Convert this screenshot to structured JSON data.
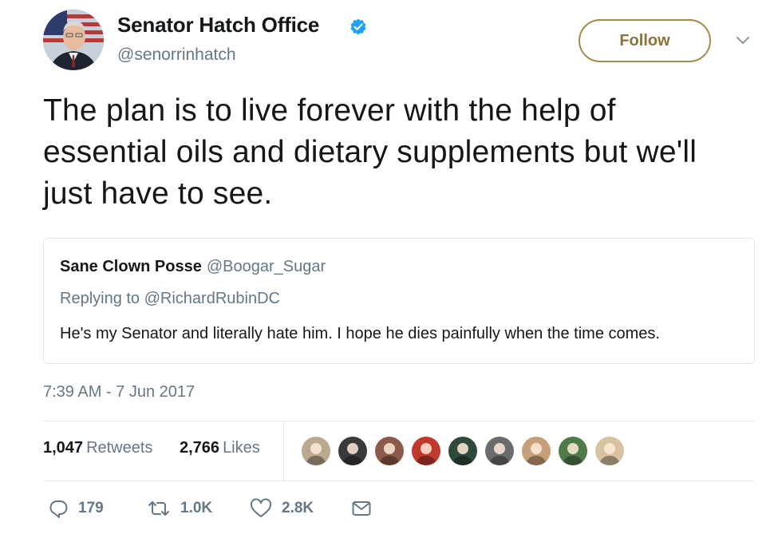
{
  "author": {
    "display_name": "Senator Hatch Office",
    "handle": "@senorrinhatch",
    "verified": true,
    "avatar_icon": "senator-portrait-avatar"
  },
  "follow_button": {
    "label": "Follow",
    "color": "#a48b4d"
  },
  "menu_icon": "chevron-down-icon",
  "tweet": {
    "text": "The plan is to live forever with the help of essential oils and dietary supplements but we'll just have to see.",
    "timestamp": "7:39 AM - 7 Jun 2017"
  },
  "quoted_tweet": {
    "display_name": "Sane Clown Posse",
    "handle": "@Boogar_Sugar",
    "replying_to": "Replying to @RichardRubinDC",
    "text": "He's my Senator and literally hate him. I hope he dies painfully when the time comes."
  },
  "stats": {
    "retweets": {
      "count": "1,047",
      "label": "Retweets"
    },
    "likes": {
      "count": "2,766",
      "label": "Likes"
    }
  },
  "likers": [
    {
      "icon": "liker-avatar-1",
      "color": "#b9a98e"
    },
    {
      "icon": "liker-avatar-2",
      "color": "#3a3a3a"
    },
    {
      "icon": "liker-avatar-3",
      "color": "#8c5a4a"
    },
    {
      "icon": "liker-avatar-4-maple-leaf",
      "color": "#c0392b"
    },
    {
      "icon": "liker-avatar-5",
      "color": "#2e4a3a"
    },
    {
      "icon": "liker-avatar-6",
      "color": "#6b6b6b"
    },
    {
      "icon": "liker-avatar-7",
      "color": "#c7a07a"
    },
    {
      "icon": "liker-avatar-8",
      "color": "#4f7b4a"
    },
    {
      "icon": "liker-avatar-9",
      "color": "#d8c3a0"
    }
  ],
  "actions": {
    "reply": {
      "icon": "reply-icon",
      "count": "179"
    },
    "retweet": {
      "icon": "retweet-icon",
      "count": "1.0K"
    },
    "like": {
      "icon": "heart-icon",
      "count": "2.8K"
    },
    "message": {
      "icon": "envelope-icon"
    }
  },
  "colors": {
    "text": "#14171a",
    "secondary": "#657786",
    "verified": "#1da1f2",
    "border": "#e1e8ed"
  }
}
